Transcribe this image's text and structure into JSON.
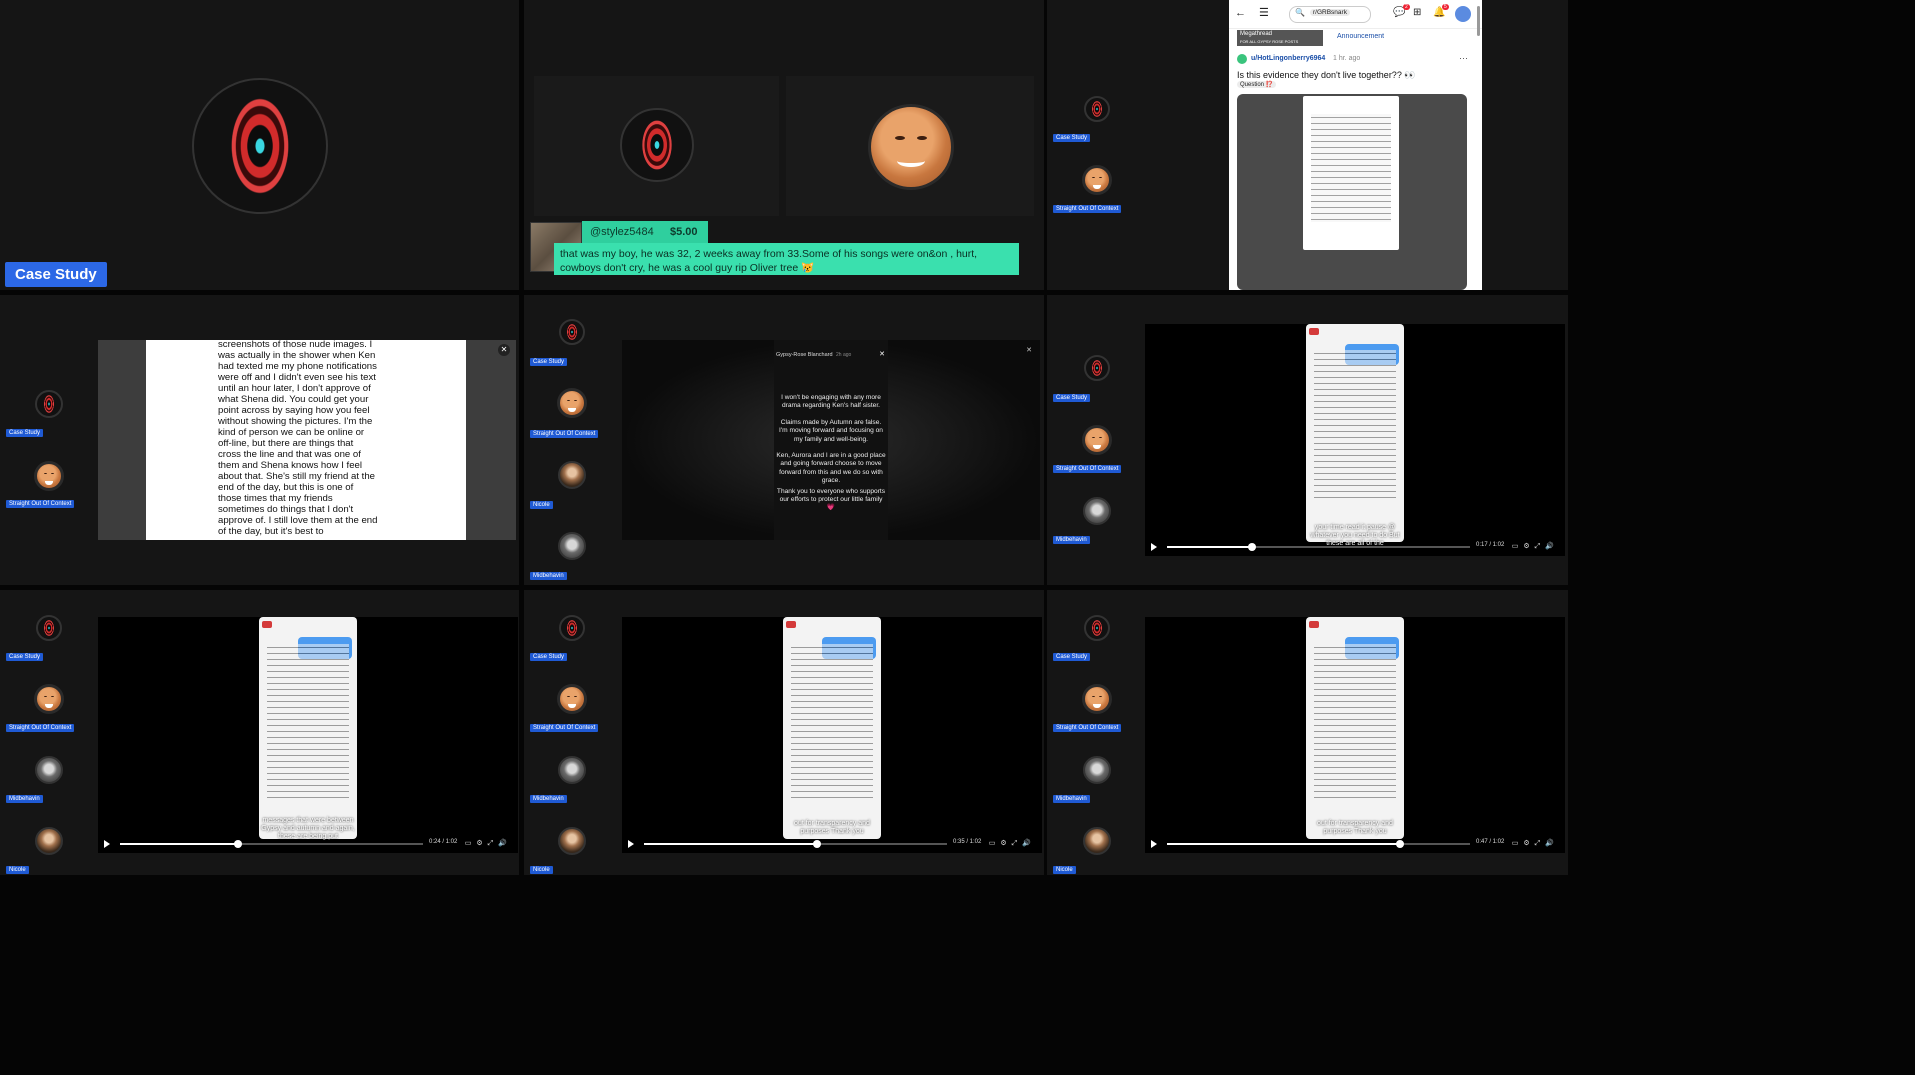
{
  "tags": {
    "case_study": "Case Study",
    "straight": "Straight Out Of Context",
    "nicole": "Nicole",
    "midbehavin": "Midbehavin"
  },
  "superchat": {
    "user": "@stylez5484",
    "amount": "$5.00",
    "message": "that was my boy, he was 32, 2 weeks away from 33.Some of his songs were on&on , hurt, cowboys don't cry, he was a cool guy rip Oliver tree 😿"
  },
  "reddit": {
    "subreddit": "r/GRBsnark",
    "megathread": "Megathread",
    "megathread_sub": "FOR ALL GYPSY ROSE POSTS",
    "announcement": "Announcement",
    "user": "u/HotLingonberry6964",
    "age": "1 hr. ago",
    "title": "Is this evidence they don't live together?? 👀",
    "flair": "Question ⁉️",
    "notifications": "5",
    "chat_badge": "2"
  },
  "doc": {
    "text": "into his personal life. The full screenshots of those nude images. I was actually in the shower when Ken had texted me my phone notifications were off and I didn't even see his text until an hour later, I don't approve of what Shena did. You could get your point across by saying how you feel without showing the pictures. I'm the kind of person we can be online or off-line, but there are things that cross the line and that was one of them and Shena knows how I feel about that. She's still my friend at the end of the day, but this is one of those times that my friends sometimes do things that I don't approve of. I still love them at the end of the day, but it's best to"
  },
  "story": {
    "user": "Gypsy-Rose Blanchard",
    "age": "2h ago",
    "p1": "I won't be engaging with any more drama regarding Ken's half sister.",
    "p2": "Claims made by Autumn are false. I'm moving forward and focusing on my family and well-being.",
    "p3": "Ken, Aurora and I are in a good place and going forward choose to move forward from this and we do so with grace.",
    "p4": "Thank you to everyone who supports our efforts to protect our little family",
    "heart": "💗"
  },
  "videos": {
    "v1": {
      "caption": "your time read it pause @ whatever you need to do But these are all of the",
      "time": "0:17 / 1:02",
      "progress": 0.28
    },
    "v2": {
      "caption": "messages that were between Gypsy and autumn and again, these are being put",
      "time": "0:24 / 1:02",
      "progress": 0.39
    },
    "v3": {
      "caption": "out for transparency and purposes Thank you",
      "time": "0:35 / 1:02",
      "progress": 0.57
    },
    "v4": {
      "caption": "out for transparency and purposes Thank you",
      "time": "0:47 / 1:02",
      "progress": 0.77
    }
  }
}
